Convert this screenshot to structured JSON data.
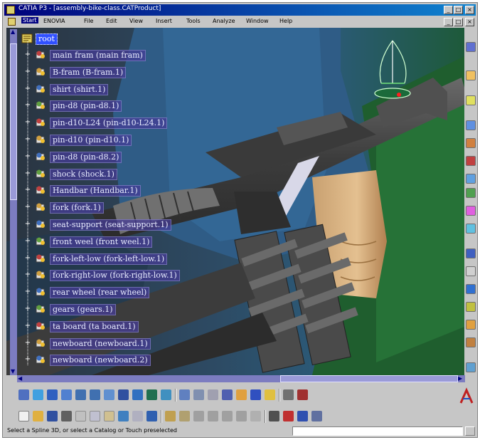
{
  "window": {
    "title": "CATIA P3 - [assembly-bike-class.CATProduct]"
  },
  "menu": {
    "items": [
      {
        "name": "start",
        "label": "Start",
        "active": true
      },
      {
        "name": "enovia",
        "label": "ENOVIA"
      },
      {
        "name": "file",
        "label": "File"
      },
      {
        "name": "edit",
        "label": "Edit"
      },
      {
        "name": "view",
        "label": "View"
      },
      {
        "name": "insert",
        "label": "Insert"
      },
      {
        "name": "tools",
        "label": "Tools"
      },
      {
        "name": "analyze",
        "label": "Analyze"
      },
      {
        "name": "window",
        "label": "Window"
      },
      {
        "name": "help",
        "label": "Help"
      }
    ]
  },
  "tree": {
    "root": "root",
    "nodes": [
      "main fram (main fram)",
      "B-fram (B-fram.1)",
      "shirt (shirt.1)",
      "pin-d8 (pin-d8.1)",
      "pin-d10-L24 (pin-d10-L24.1)",
      "pin-d10 (pin-d10.1)",
      "pin-d8 (pin-d8.2)",
      "shock (shock.1)",
      "Handbar (Handbar.1)",
      "fork (fork.1)",
      "seat-support (seat-support.1)",
      "front weel (front weel.1)",
      "fork-left-low (fork-left-low.1)",
      "fork-right-low (fork-right-low.1)",
      "rear wheel (rear wheel)",
      "gears (gears.1)",
      "ta board (ta board.1)",
      "newboard (newboard.1)",
      "newboard (newboard.2)"
    ]
  },
  "status": {
    "text": "Select a Spline 3D, or select a Catalog or Touch preselected"
  },
  "colors": {
    "title_bar": "#00007b",
    "tree_label_bg": "#463c96",
    "root_selected": "#3050ff",
    "scroll": "#7c7cc0"
  }
}
